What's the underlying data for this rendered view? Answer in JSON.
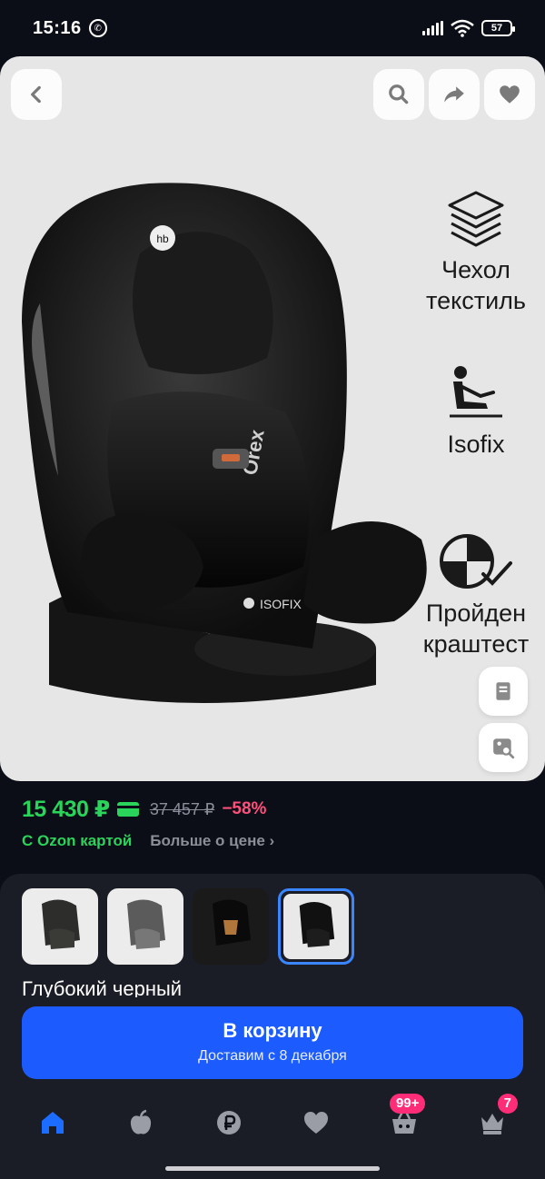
{
  "status": {
    "time": "15:16",
    "battery": "57"
  },
  "hero": {
    "features": [
      {
        "label_line1": "Чехол",
        "label_line2": "текстиль",
        "icon": "layers-icon"
      },
      {
        "label_line1": "Isofix",
        "label_line2": "",
        "icon": "car-seat-icon"
      },
      {
        "label_line1": "Пройден",
        "label_line2": "краштест",
        "icon": "crash-test-icon"
      }
    ],
    "brand_marks": {
      "logo": "hb",
      "model": "Orex",
      "isofix": "ISOFIX"
    }
  },
  "price": {
    "current": "15 430 ₽",
    "old": "37 457 ₽",
    "discount": "−58%",
    "ozon_card": "С Ozon картой",
    "more": "Больше о цене"
  },
  "variants": {
    "selected_name": "Глубокий черный",
    "thumbs": [
      "variant-1",
      "variant-2",
      "variant-3",
      "variant-4"
    ]
  },
  "cart": {
    "title": "В корзину",
    "subtitle": "Доставим с 8 декабря"
  },
  "nav": {
    "cart_badge": "99+",
    "profile_badge": "7"
  },
  "colors": {
    "accent_green": "#2ad35a",
    "accent_blue": "#1c5cff",
    "discount_pink": "#ff4f7b",
    "badge_pink": "#ff2d78"
  }
}
